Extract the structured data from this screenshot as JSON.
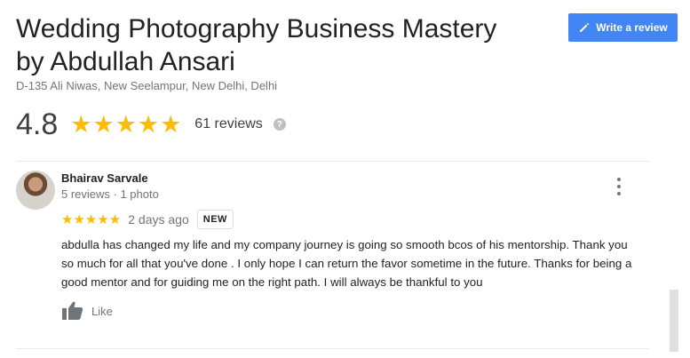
{
  "business": {
    "name": "Wedding Photography Business Mastery by Abdullah Ansari",
    "address": "D-135 Ali Niwas, New Seelampur, New Delhi, Delhi",
    "rating": "4.8",
    "stars": "★★★★★",
    "review_count": "61 reviews",
    "help_glyph": "?"
  },
  "actions": {
    "write_review_label": "Write a review",
    "write_review_icon": "pencil-icon"
  },
  "review": {
    "reviewer_name": "Bhairav Sarvale",
    "reviewer_meta": "5 reviews · 1 photo",
    "stars": "★★★★★",
    "date": "2 days ago",
    "badge": "NEW",
    "text": "abdulla has changed my life and my company journey is going so smooth bcos of his mentorship. Thank you so much for all that you've done . I only hope I can return the favor sometime in the future. Thanks for being a good mentor and for guiding me on the right path. I will always be thankful to you",
    "like_label": "Like"
  },
  "colors": {
    "accent": "#4285f4",
    "star": "#fbbc04",
    "muted_text": "#70757a"
  }
}
